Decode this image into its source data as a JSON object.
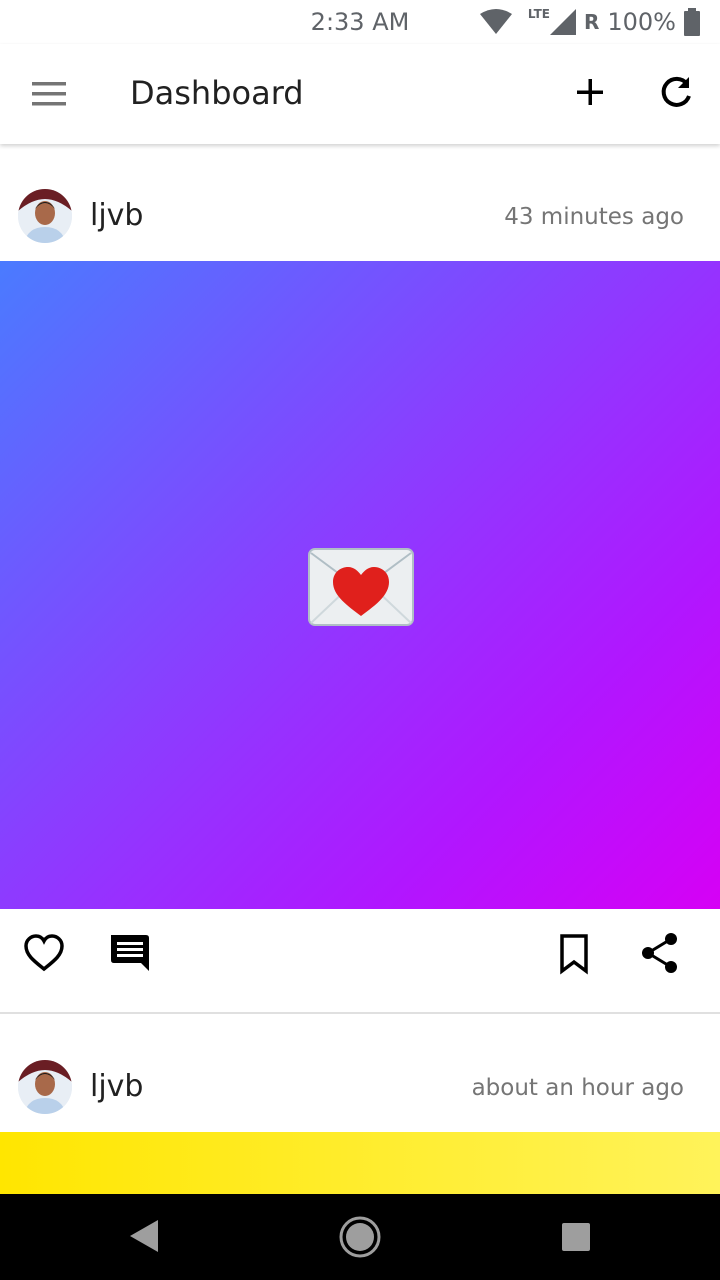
{
  "status_bar": {
    "time": "2:33 AM",
    "network": "LTE",
    "roaming": "R",
    "battery": "100%"
  },
  "app_bar": {
    "title": "Dashboard",
    "icons": [
      "menu-icon",
      "add-icon",
      "refresh-icon"
    ]
  },
  "posts": [
    {
      "username": "ljvb",
      "timestamp": "43 minutes ago",
      "content_emoji": "love-letter",
      "background": [
        "#4a7bff",
        "#d600f5"
      ],
      "actions": [
        "like-icon",
        "comment-icon",
        "bookmark-icon",
        "share-icon"
      ]
    },
    {
      "username": "ljvb",
      "timestamp": "about an hour ago",
      "background": [
        "#ffe600",
        "#fff35a"
      ]
    }
  ],
  "nav_bar": {
    "icons": [
      "back-icon",
      "home-icon",
      "recents-icon"
    ]
  }
}
